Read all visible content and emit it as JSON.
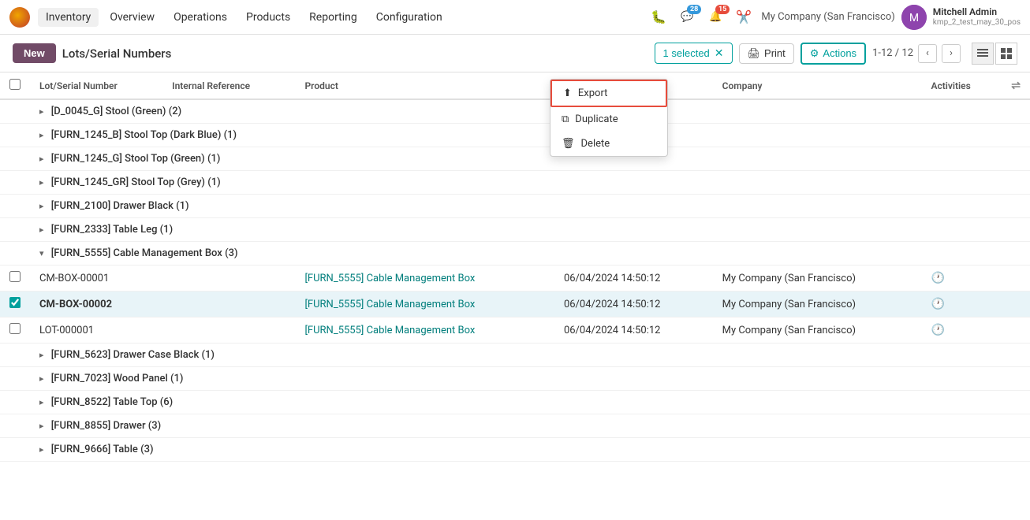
{
  "nav": {
    "logo_title": "Odoo",
    "items": [
      "Inventory",
      "Overview",
      "Operations",
      "Products",
      "Reporting",
      "Configuration"
    ],
    "active": "Inventory",
    "notifications_count": "15",
    "messages_count": "28",
    "company": "My Company (San Francisco)",
    "user_name": "Mitchell Admin",
    "user_sub": "kmp_2_test_may_30_pos"
  },
  "toolbar": {
    "new_label": "New",
    "page_title": "Lots/Serial Numbers",
    "selected_label": "1 selected",
    "print_label": "Print",
    "actions_label": "Actions",
    "pager": "1-12 / 12"
  },
  "actions_menu": {
    "items": [
      {
        "id": "export",
        "label": "Export",
        "icon": "export"
      },
      {
        "id": "duplicate",
        "label": "Duplicate",
        "icon": "copy"
      },
      {
        "id": "delete",
        "label": "Delete",
        "icon": "trash"
      }
    ]
  },
  "table": {
    "columns": [
      "Lot/Serial Number",
      "Internal Reference",
      "Product",
      "",
      "Company",
      "Activities",
      ""
    ],
    "groups": [
      {
        "id": "d0045g",
        "label": "[D_0045_G] Stool (Green) (2)",
        "expanded": false,
        "rows": []
      },
      {
        "id": "furn1245b",
        "label": "[FURN_1245_B] Stool Top (Dark Blue) (1)",
        "expanded": false,
        "rows": []
      },
      {
        "id": "furn1245g",
        "label": "[FURN_1245_G] Stool Top (Green) (1)",
        "expanded": false,
        "rows": []
      },
      {
        "id": "furn1245gr",
        "label": "[FURN_1245_GR] Stool Top (Grey) (1)",
        "expanded": false,
        "rows": []
      },
      {
        "id": "furn2100",
        "label": "[FURN_2100] Drawer Black (1)",
        "expanded": false,
        "rows": []
      },
      {
        "id": "furn2333",
        "label": "[FURN_2333] Table Leg (1)",
        "expanded": false,
        "rows": []
      },
      {
        "id": "furn5555",
        "label": "[FURN_5555] Cable Management Box (3)",
        "expanded": true,
        "rows": [
          {
            "id": "row1",
            "lot": "CM-BOX-00001",
            "internal_ref": "",
            "product": "[FURN_5555] Cable Management Box",
            "date": "06/04/2024 14:50:12",
            "company": "My Company (San Francisco)",
            "checked": false,
            "bold": false,
            "highlighted": false
          },
          {
            "id": "row2",
            "lot": "CM-BOX-00002",
            "internal_ref": "",
            "product": "[FURN_5555] Cable Management Box",
            "date": "06/04/2024 14:50:12",
            "company": "My Company (San Francisco)",
            "checked": true,
            "bold": true,
            "highlighted": true
          },
          {
            "id": "row3",
            "lot": "LOT-000001",
            "internal_ref": "",
            "product": "[FURN_5555] Cable Management Box",
            "date": "06/04/2024 14:50:12",
            "company": "My Company (San Francisco)",
            "checked": false,
            "bold": false,
            "highlighted": false
          }
        ]
      },
      {
        "id": "furn5623",
        "label": "[FURN_5623] Drawer Case Black (1)",
        "expanded": false,
        "rows": []
      },
      {
        "id": "furn7023",
        "label": "[FURN_7023] Wood Panel (1)",
        "expanded": false,
        "rows": []
      },
      {
        "id": "furn8522",
        "label": "[FURN_8522] Table Top (6)",
        "expanded": false,
        "rows": []
      },
      {
        "id": "furn8855",
        "label": "[FURN_8855] Drawer (3)",
        "expanded": false,
        "rows": []
      },
      {
        "id": "furn9666",
        "label": "[FURN_9666] Table (3)",
        "expanded": false,
        "rows": []
      }
    ]
  },
  "colors": {
    "accent": "#714b67",
    "teal": "#00a09d",
    "highlight_bg": "#e8f4f8",
    "export_border": "#e74c3c"
  }
}
